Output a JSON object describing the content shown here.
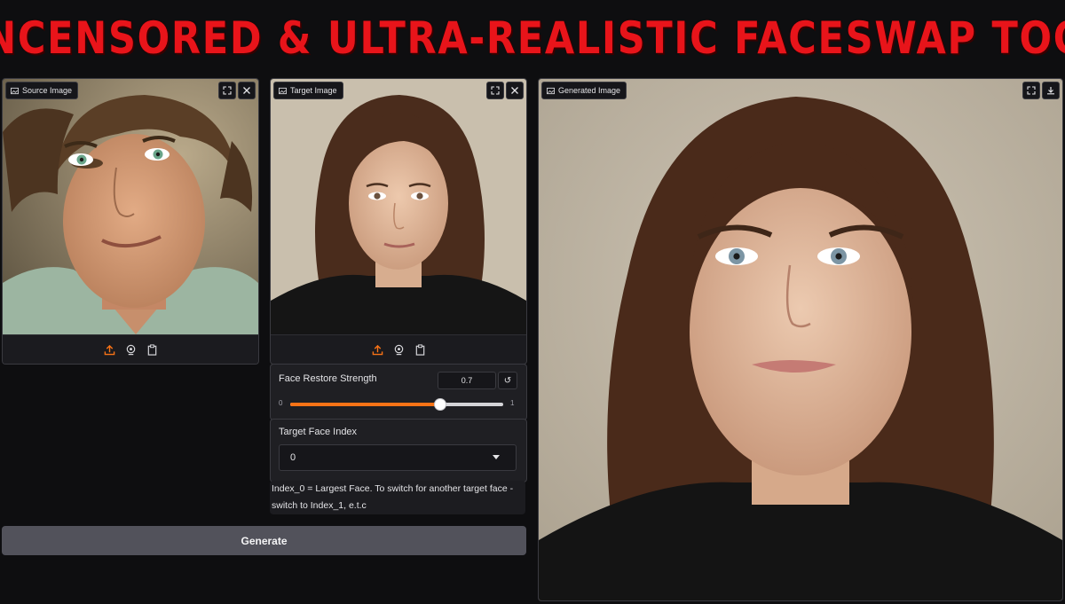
{
  "banner": {
    "title": "UNCENSORED & ULTRA-REALISTIC FACESWAP TOOL"
  },
  "source_panel": {
    "label": "Source Image",
    "corner_icons": [
      "fullscreen-icon",
      "close-icon"
    ],
    "toolbar_icons": [
      "upload-icon",
      "webcam-icon",
      "clipboard-icon"
    ]
  },
  "target_panel": {
    "label": "Target Image",
    "corner_icons": [
      "fullscreen-icon",
      "close-icon"
    ],
    "toolbar_icons": [
      "upload-icon",
      "webcam-icon",
      "clipboard-icon"
    ]
  },
  "generated_panel": {
    "label": "Generated Image",
    "corner_icons": [
      "fullscreen-icon",
      "download-icon"
    ]
  },
  "face_restore": {
    "label": "Face Restore Strength",
    "value": "0.7",
    "min_label": "0",
    "max_label": "1",
    "fraction": 0.7,
    "reset_icon": "reset-icon"
  },
  "target_face_index": {
    "label": "Target Face Index",
    "selected": "0"
  },
  "info": {
    "line1": "Index_0 = Largest Face. To switch for another target face -",
    "line2": "switch to Index_1, e.t.c"
  },
  "generate_button": {
    "label": "Generate"
  },
  "colors": {
    "accent": "#f97316",
    "banner_red": "#e8141a",
    "panel_bg": "#1f1f23",
    "page_bg": "#0e0e10"
  }
}
